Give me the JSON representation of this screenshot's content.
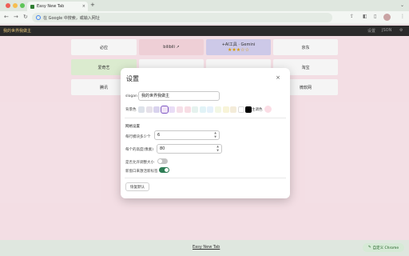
{
  "browser": {
    "tab_title": "Easy New Tab",
    "tab_close": "×",
    "new_tab": "+",
    "back": "←",
    "forward": "→",
    "reload": "↻",
    "address_placeholder": "在 Google 中搜索，或输入网址",
    "share_icon": "⇪",
    "extension_icon": "◧",
    "sidepanel_icon": "▯",
    "menu_icon": "⋮",
    "tab_dropdown": "⌄"
  },
  "app": {
    "brand": "我的世界我做主",
    "nav_right": [
      "设置",
      "JSON",
      "⚙"
    ]
  },
  "sites": [
    {
      "name": "必应",
      "bg": "#ffffff"
    },
    {
      "name": "bilibili ↗",
      "bg": "#f8d8df"
    },
    {
      "name": "+AI工具 · Gemini",
      "bg": "#d6d2f2",
      "stars": "★★★☆☆"
    },
    {
      "name": "京东",
      "bg": "#ffffff"
    },
    {
      "name": "爱奇艺",
      "bg": "#e4f5d8"
    },
    {
      "name": "",
      "bg": "#ffffff"
    },
    {
      "name": "",
      "bg": "#ffffff"
    },
    {
      "name": "淘宝",
      "bg": "#ffffff"
    },
    {
      "name": "腾讯",
      "bg": "#ffffff"
    },
    {
      "name": "",
      "bg": "#ffffff"
    },
    {
      "name": "",
      "bg": "#ffffff"
    },
    {
      "name": "微软网",
      "bg": "#ffffff"
    }
  ],
  "settings": {
    "title": "设置",
    "close": "×",
    "slogan_label": "slogan",
    "slogan_value": "我的世界我做主",
    "bg_label": "背景色",
    "swatch_colors": [
      "#dde2ea",
      "#e6e1ea",
      "#d9d3ee",
      "#f0e4f6",
      "#e9ddf6",
      "#f6dfe8",
      "#f8dde4",
      "#e5f2ee",
      "#e1f3f7",
      "#e5f1fb",
      "#f3f7e4",
      "#f8f4d8",
      "#f4ecd9",
      "#ffffff",
      "#000000"
    ],
    "selected_swatch": 3,
    "theme_label": "主调色",
    "theme_color": "#fbdde5",
    "grid_heading": "网格设置",
    "cols_label": "每行模块多少个",
    "cols_value": "6",
    "height_label": "每个的高度(像素)",
    "height_value": "80",
    "toggle1_label": "是否允许调整大小",
    "toggle1_on": false,
    "toggle2_label": "新窗口来激活新标签",
    "toggle2_on": true,
    "reset_label": "恢复默认"
  },
  "footer": {
    "link": "Easy New Tab",
    "customize": "自定义 Chrome"
  },
  "colors": {
    "page_bg": "#fde8ee",
    "accent_green": "#2e7d55",
    "toggle_off": "#c5c5c5"
  }
}
